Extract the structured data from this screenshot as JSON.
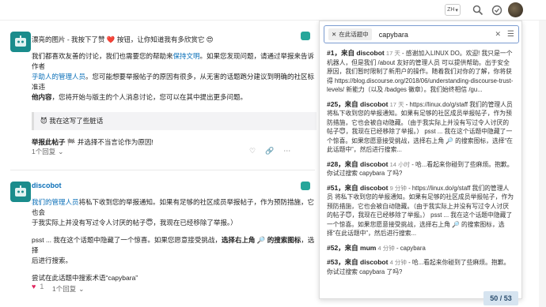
{
  "header": {
    "lang_label": "ZH",
    "search_icon": "search-icon",
    "notifications_icon": "notification-icon",
    "avatar_icon": "user-avatar"
  },
  "post1": {
    "first_line": "漂亮的图片 - 我按下了赞 ❤️ 按钮，让你知道我有多欣赏它 😍",
    "para_a": "我们都喜欢友善的讨论，我们也需要您的帮助来",
    "para_link1": "保持文明",
    "para_b": "。如果您发现问题，请通过举报来告诉作者",
    "para_link2": "乎助人的管理人员",
    "para_c": "。您可能想要举报帖子的原因有很多，从无害的话题跑分建议到明确的社区标准违",
    "para_bold": "他内容",
    "para_d": "，您将开始与版主的个人消息讨论，您可以在其中提出更多问题。",
    "quote": "😈 我在这写了些脏话",
    "instr_bold": "举报此帖子",
    "instr_rest": " 🏁 并选择不当言论作为原因!",
    "reply_label": "1个回复"
  },
  "post2": {
    "username": "discobot",
    "line1_link": "我们的管理人员",
    "line1_rest": "将私下收到您的举报通知。如果有足够的社区成员举报帖子，作为预防措施，它也会",
    "line1_b": "于我实际上并没有写过令人讨厌的帖子😇，我现在已经移除了举报。）",
    "psst_a": "psst ... 我在这个话题中隐藏了一个惊喜。如果您愿意接受挑战，",
    "psst_bold": "选择右上角 🔎 的搜索图标",
    "psst_b": "，选择",
    "psst_c": "后进行搜索。",
    "try": "尝试在此话题中搜索术语“capybara”",
    "reply_label": "1个回复"
  },
  "search": {
    "context_label": "在此话题中",
    "query": "capybara",
    "results": [
      {
        "head": "#1，来自 discobot",
        "age": "17 天",
        "body": " - 感谢加入LINUX DO。欢迎! 我只是一个机器人，但是我们 /about 友好的管理人员 可以提供帮助。出于安全原因，我们暂时限制了新用户的操作。随着我们对你的了解，你将获得 https://blog.discourse.org/2018/06/understanding-discourse-trust-levels/ 新能力（以及 /badges 徽章）。我们始终相信 /gu..."
      },
      {
        "head": "#25，来自 discobot",
        "age": "17 天",
        "body": " - https://linux.do/g/staff 我们的管理人员 将私下收到您的举报通知。如果有足够的社区成员举报帖子，作为预防措施，它也会被自动隐藏。（由于我实际上并没有写过令人讨厌的帖子😇，我现在已经移除了举报。） psst ... 我在这个话题中隐藏了一个惊喜。如果您愿意接受挑战，选择右上角 🔎 的搜索图标，选择“在此话题中”，然后进行搜索..."
      },
      {
        "head": "#28，来自 discobot",
        "age": "14 小时",
        "body": " - 哈...看起来你碰到了些麻烦。抱歉。你试过搜索 capybara 了吗?"
      },
      {
        "head": "#51，来自 discobot",
        "age": "9 分钟",
        "body": " - https://linux.do/g/staff 我们的管理人员 将私下收到您的举报通知。如果有足够的社区成员举报帖子，作为预防措施，它也会被自动隐藏。（由于我实际上并没有写过令人讨厌的帖子😇，我现在已经移除了举报。） psst ... 我在这个话题中隐藏了一个惊喜。如果您愿意接受挑战，选择右上角 🔎 的搜索图标，选择“在此话题中”，然后进行搜索..."
      },
      {
        "head": "#52，来自 mum",
        "age": "4 分钟",
        "body": " - capybara"
      },
      {
        "head": "#53，来自 discobot",
        "age": "4 分钟",
        "body": " - 哈...看起来你碰到了些麻烦。抱歉。你试过搜索 capybara 了吗?"
      }
    ]
  },
  "timeline": "50 / 53",
  "colors": {
    "accent": "#0a6fb8",
    "bot": "#1a8c8c"
  }
}
